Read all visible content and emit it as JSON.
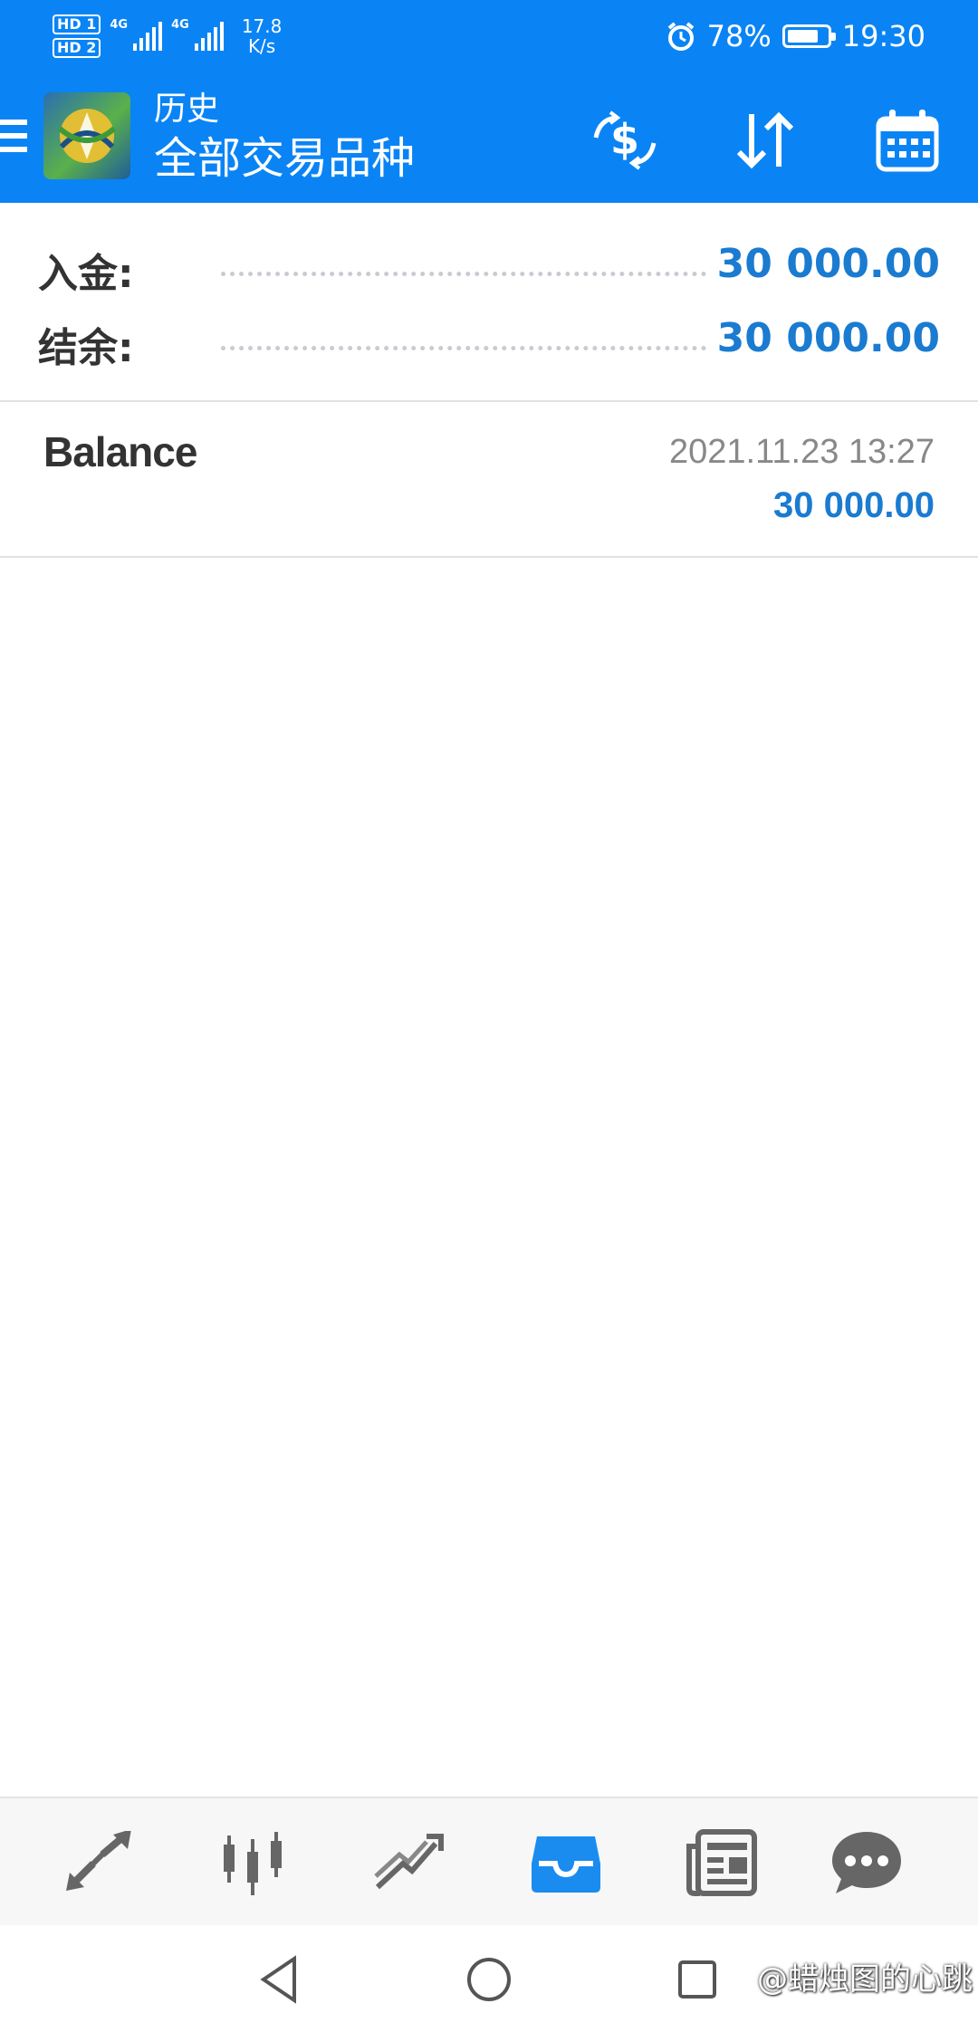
{
  "status_bar": {
    "sim1": "HD 1",
    "sim2": "HD 2",
    "net1": "4G",
    "net2": "4G",
    "speed_value": "17.8",
    "speed_unit": "K/s",
    "battery": "78%",
    "battery_level": 0.78,
    "time": "19:30"
  },
  "app_bar": {
    "subtitle": "历史",
    "title": "全部交易品种",
    "accent_color": "#0a84f5"
  },
  "summary": {
    "rows": [
      {
        "label": "入金:",
        "value": "30 000.00"
      },
      {
        "label": "结余:",
        "value": "30 000.00"
      }
    ]
  },
  "deals": [
    {
      "type": "Balance",
      "time": "2021.11.23 13:27",
      "amount": "30 000.00"
    }
  ],
  "bottom_nav": {
    "items": [
      {
        "icon": "quotes-icon",
        "active": false
      },
      {
        "icon": "chart-icon",
        "active": false
      },
      {
        "icon": "trade-icon",
        "active": false
      },
      {
        "icon": "history-icon",
        "active": true
      },
      {
        "icon": "news-icon",
        "active": false
      },
      {
        "icon": "messages-icon",
        "active": false
      }
    ],
    "active_color": "#1a8cf0"
  },
  "watermark": "@蜡烛图的心跳"
}
